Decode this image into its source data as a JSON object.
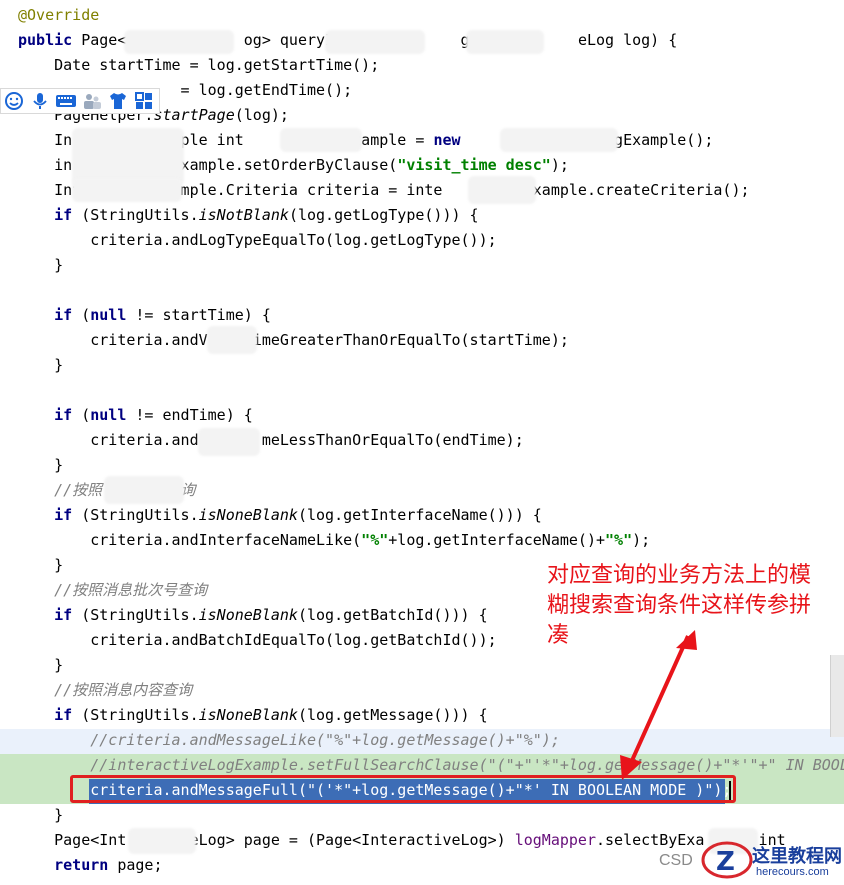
{
  "code_lines": [
    {
      "id": "l0",
      "parts": [
        [
          "ann",
          "@Override"
        ]
      ]
    },
    {
      "id": "l1",
      "parts": [
        [
          "kw",
          "public "
        ],
        [
          "",
          "Page<"
        ],
        [
          "",
          "             "
        ],
        [
          "",
          "og> queryI"
        ],
        [
          "",
          "              "
        ],
        [
          "",
          "g(In"
        ],
        [
          "",
          "         "
        ],
        [
          "",
          "eLog log) {"
        ]
      ]
    },
    {
      "id": "l2",
      "parts": [
        [
          "",
          "    Date startTime = log.getStartTime();"
        ]
      ]
    },
    {
      "id": "l3",
      "parts": [
        [
          "",
          "                  = log.getEndTime();"
        ]
      ]
    },
    {
      "id": "l4",
      "parts": [
        [
          "",
          "    PageHelper."
        ],
        [
          "mtd",
          "startPage"
        ],
        [
          "",
          "(log);"
        ]
      ]
    },
    {
      "id": "l5",
      "parts": [
        [
          "",
          "    In"
        ],
        [
          "",
          "        "
        ],
        [
          "",
          "Example int"
        ],
        [
          "",
          "         "
        ],
        [
          "",
          "ogExample = "
        ],
        [
          "kw",
          "new "
        ],
        [
          "",
          "             "
        ],
        [
          "",
          "eLogExample();"
        ]
      ]
    },
    {
      "id": "l6",
      "parts": [
        [
          "",
          "    in"
        ],
        [
          "",
          "          "
        ],
        [
          "",
          "gExample.setOrderByClause("
        ],
        [
          "str",
          "\"visit_time desc\""
        ],
        [
          "",
          ");"
        ]
      ]
    },
    {
      "id": "l7",
      "parts": [
        [
          "",
          "    Inte"
        ],
        [
          "",
          "       "
        ],
        [
          "",
          "Example.Criteria criteria = inte"
        ],
        [
          "",
          "      "
        ],
        [
          "",
          "logExample.createCriteria();"
        ]
      ]
    },
    {
      "id": "l8",
      "parts": [
        [
          "kw",
          "    if "
        ],
        [
          "",
          "(StringUtils."
        ],
        [
          "mtd",
          "isNotBlank"
        ],
        [
          "",
          "(log.getLogType())) {"
        ]
      ]
    },
    {
      "id": "l9",
      "parts": [
        [
          "",
          "        criteria.andLogTypeEqualTo(log.getLogType());"
        ]
      ]
    },
    {
      "id": "l10",
      "parts": [
        [
          "",
          "    }"
        ]
      ]
    },
    {
      "id": "l11",
      "parts": [
        [
          "",
          ""
        ]
      ]
    },
    {
      "id": "l12",
      "parts": [
        [
          "kw",
          "    if "
        ],
        [
          "",
          "("
        ],
        [
          "kw",
          "null "
        ],
        [
          "",
          "!= startTime) {"
        ]
      ]
    },
    {
      "id": "l13",
      "parts": [
        [
          "",
          "        criteria.andV"
        ],
        [
          "",
          "     "
        ],
        [
          "",
          "imeGreaterThanOrEqualTo(startTime);"
        ]
      ]
    },
    {
      "id": "l14",
      "parts": [
        [
          "",
          "    }"
        ]
      ]
    },
    {
      "id": "l15",
      "parts": [
        [
          "",
          ""
        ]
      ]
    },
    {
      "id": "l16",
      "parts": [
        [
          "kw",
          "    if "
        ],
        [
          "",
          "("
        ],
        [
          "kw",
          "null "
        ],
        [
          "",
          "!= endTime) {"
        ]
      ]
    },
    {
      "id": "l17",
      "parts": [
        [
          "",
          "        criteria.and"
        ],
        [
          "",
          "       "
        ],
        [
          "",
          "meLessThanOrEqualTo(endTime);"
        ]
      ]
    },
    {
      "id": "l18",
      "parts": [
        [
          "",
          "    }"
        ]
      ]
    },
    {
      "id": "l19",
      "parts": [
        [
          "cmt",
          "    //按照"
        ],
        [
          "",
          "       "
        ],
        [
          "cmt",
          "查询"
        ]
      ]
    },
    {
      "id": "l20",
      "parts": [
        [
          "kw",
          "    if "
        ],
        [
          "",
          "(StringUtils."
        ],
        [
          "mtd",
          "isNoneBlank"
        ],
        [
          "",
          "(log.getInterfaceName())) {"
        ]
      ]
    },
    {
      "id": "l21",
      "parts": [
        [
          "",
          "        criteria.andInterfaceNameLike("
        ],
        [
          "str",
          "\"%\""
        ],
        [
          "",
          "+log.getInterfaceName()+"
        ],
        [
          "str",
          "\"%\""
        ],
        [
          "",
          ");"
        ]
      ]
    },
    {
      "id": "l22",
      "parts": [
        [
          "",
          "    }"
        ]
      ]
    },
    {
      "id": "l23",
      "parts": [
        [
          "cmt",
          "    //按照消息批次号查询"
        ]
      ]
    },
    {
      "id": "l24",
      "parts": [
        [
          "kw",
          "    if "
        ],
        [
          "",
          "(StringUtils."
        ],
        [
          "mtd",
          "isNoneBlank"
        ],
        [
          "",
          "(log.getBatchId())) {"
        ]
      ]
    },
    {
      "id": "l25",
      "parts": [
        [
          "",
          "        criteria.andBatchIdEqualTo(log.getBatchId());"
        ]
      ]
    },
    {
      "id": "l26",
      "parts": [
        [
          "",
          "    }"
        ]
      ]
    },
    {
      "id": "l27",
      "parts": [
        [
          "cmt",
          "    //按照消息内容查询"
        ]
      ]
    },
    {
      "id": "l28",
      "parts": [
        [
          "kw",
          "    if "
        ],
        [
          "",
          "(StringUtils."
        ],
        [
          "mtd",
          "isNoneBlank"
        ],
        [
          "",
          "(log.getMessage())) {"
        ]
      ]
    },
    {
      "id": "l29",
      "parts": [
        [
          "cmt",
          "        //criteria.andMessageLike(\"%\"+log.getMessage()+\"%\");"
        ]
      ]
    },
    {
      "id": "l30",
      "parts": [
        [
          "cmt",
          "        //interactiveLogExample.setFullSearchClause(\"(\"+\"'*\"+log.getMessage()+\"*'\"+\" IN BOOLEAN MODE )\");"
        ]
      ]
    },
    {
      "id": "l31",
      "parts": [
        [
          "sel",
          "        criteria.andMessageFull(\"('*\"+log.getMessage()+\"*' IN BOOLEAN MODE )\");"
        ]
      ]
    },
    {
      "id": "l32",
      "parts": [
        [
          "",
          "    }"
        ]
      ]
    },
    {
      "id": "l33",
      "parts": [
        [
          "",
          "    Page<Int"
        ],
        [
          "",
          "       "
        ],
        [
          "",
          "eLog> page = (Page<InteractiveLog>) "
        ],
        [
          "fld",
          "logMapper"
        ],
        [
          "",
          ".selectByExa"
        ],
        [
          "",
          "    "
        ],
        [
          "",
          "l(int"
        ],
        [
          "",
          "      "
        ]
      ]
    },
    {
      "id": "l34",
      "parts": [
        [
          "kw",
          "    return "
        ],
        [
          "",
          "page;"
        ]
      ]
    }
  ],
  "annotation_text": "对应查询的业务方法上的模糊搜索查询条件这样传参拼凑",
  "watermark_text": "CSD",
  "logo": {
    "title": "这里教程网",
    "url": "herecours.com"
  },
  "toolbar_icons": [
    "smiley-icon",
    "microphone-icon",
    "keyboard-icon",
    "users-icon",
    "shirt-icon",
    "grid-icon"
  ],
  "colors": {
    "keyword": "#000080",
    "string": "#008000",
    "comment": "#808080",
    "annotation": "#808000",
    "selection": "#3d6db6",
    "highlight_green": "#c9e6c3",
    "note_red": "#e8141a"
  }
}
